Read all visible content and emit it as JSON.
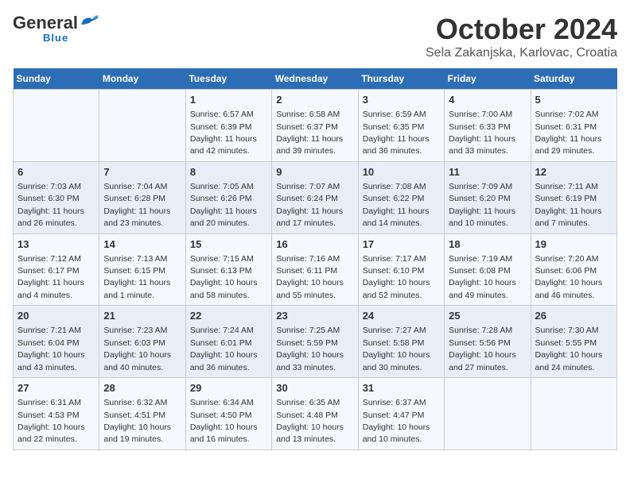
{
  "header": {
    "logo_general": "General",
    "logo_blue": "Blue",
    "title": "October 2024",
    "subtitle": "Sela Zakanjska, Karlovac, Croatia"
  },
  "weekdays": [
    "Sunday",
    "Monday",
    "Tuesday",
    "Wednesday",
    "Thursday",
    "Friday",
    "Saturday"
  ],
  "weeks": [
    [
      {
        "day": "",
        "info": ""
      },
      {
        "day": "",
        "info": ""
      },
      {
        "day": "1",
        "info": "Sunrise: 6:57 AM\nSunset: 6:39 PM\nDaylight: 11 hours and 42 minutes."
      },
      {
        "day": "2",
        "info": "Sunrise: 6:58 AM\nSunset: 6:37 PM\nDaylight: 11 hours and 39 minutes."
      },
      {
        "day": "3",
        "info": "Sunrise: 6:59 AM\nSunset: 6:35 PM\nDaylight: 11 hours and 36 minutes."
      },
      {
        "day": "4",
        "info": "Sunrise: 7:00 AM\nSunset: 6:33 PM\nDaylight: 11 hours and 33 minutes."
      },
      {
        "day": "5",
        "info": "Sunrise: 7:02 AM\nSunset: 6:31 PM\nDaylight: 11 hours and 29 minutes."
      }
    ],
    [
      {
        "day": "6",
        "info": "Sunrise: 7:03 AM\nSunset: 6:30 PM\nDaylight: 11 hours and 26 minutes."
      },
      {
        "day": "7",
        "info": "Sunrise: 7:04 AM\nSunset: 6:28 PM\nDaylight: 11 hours and 23 minutes."
      },
      {
        "day": "8",
        "info": "Sunrise: 7:05 AM\nSunset: 6:26 PM\nDaylight: 11 hours and 20 minutes."
      },
      {
        "day": "9",
        "info": "Sunrise: 7:07 AM\nSunset: 6:24 PM\nDaylight: 11 hours and 17 minutes."
      },
      {
        "day": "10",
        "info": "Sunrise: 7:08 AM\nSunset: 6:22 PM\nDaylight: 11 hours and 14 minutes."
      },
      {
        "day": "11",
        "info": "Sunrise: 7:09 AM\nSunset: 6:20 PM\nDaylight: 11 hours and 10 minutes."
      },
      {
        "day": "12",
        "info": "Sunrise: 7:11 AM\nSunset: 6:19 PM\nDaylight: 11 hours and 7 minutes."
      }
    ],
    [
      {
        "day": "13",
        "info": "Sunrise: 7:12 AM\nSunset: 6:17 PM\nDaylight: 11 hours and 4 minutes."
      },
      {
        "day": "14",
        "info": "Sunrise: 7:13 AM\nSunset: 6:15 PM\nDaylight: 11 hours and 1 minute."
      },
      {
        "day": "15",
        "info": "Sunrise: 7:15 AM\nSunset: 6:13 PM\nDaylight: 10 hours and 58 minutes."
      },
      {
        "day": "16",
        "info": "Sunrise: 7:16 AM\nSunset: 6:11 PM\nDaylight: 10 hours and 55 minutes."
      },
      {
        "day": "17",
        "info": "Sunrise: 7:17 AM\nSunset: 6:10 PM\nDaylight: 10 hours and 52 minutes."
      },
      {
        "day": "18",
        "info": "Sunrise: 7:19 AM\nSunset: 6:08 PM\nDaylight: 10 hours and 49 minutes."
      },
      {
        "day": "19",
        "info": "Sunrise: 7:20 AM\nSunset: 6:06 PM\nDaylight: 10 hours and 46 minutes."
      }
    ],
    [
      {
        "day": "20",
        "info": "Sunrise: 7:21 AM\nSunset: 6:04 PM\nDaylight: 10 hours and 43 minutes."
      },
      {
        "day": "21",
        "info": "Sunrise: 7:23 AM\nSunset: 6:03 PM\nDaylight: 10 hours and 40 minutes."
      },
      {
        "day": "22",
        "info": "Sunrise: 7:24 AM\nSunset: 6:01 PM\nDaylight: 10 hours and 36 minutes."
      },
      {
        "day": "23",
        "info": "Sunrise: 7:25 AM\nSunset: 5:59 PM\nDaylight: 10 hours and 33 minutes."
      },
      {
        "day": "24",
        "info": "Sunrise: 7:27 AM\nSunset: 5:58 PM\nDaylight: 10 hours and 30 minutes."
      },
      {
        "day": "25",
        "info": "Sunrise: 7:28 AM\nSunset: 5:56 PM\nDaylight: 10 hours and 27 minutes."
      },
      {
        "day": "26",
        "info": "Sunrise: 7:30 AM\nSunset: 5:55 PM\nDaylight: 10 hours and 24 minutes."
      }
    ],
    [
      {
        "day": "27",
        "info": "Sunrise: 6:31 AM\nSunset: 4:53 PM\nDaylight: 10 hours and 22 minutes."
      },
      {
        "day": "28",
        "info": "Sunrise: 6:32 AM\nSunset: 4:51 PM\nDaylight: 10 hours and 19 minutes."
      },
      {
        "day": "29",
        "info": "Sunrise: 6:34 AM\nSunset: 4:50 PM\nDaylight: 10 hours and 16 minutes."
      },
      {
        "day": "30",
        "info": "Sunrise: 6:35 AM\nSunset: 4:48 PM\nDaylight: 10 hours and 13 minutes."
      },
      {
        "day": "31",
        "info": "Sunrise: 6:37 AM\nSunset: 4:47 PM\nDaylight: 10 hours and 10 minutes."
      },
      {
        "day": "",
        "info": ""
      },
      {
        "day": "",
        "info": ""
      }
    ]
  ]
}
